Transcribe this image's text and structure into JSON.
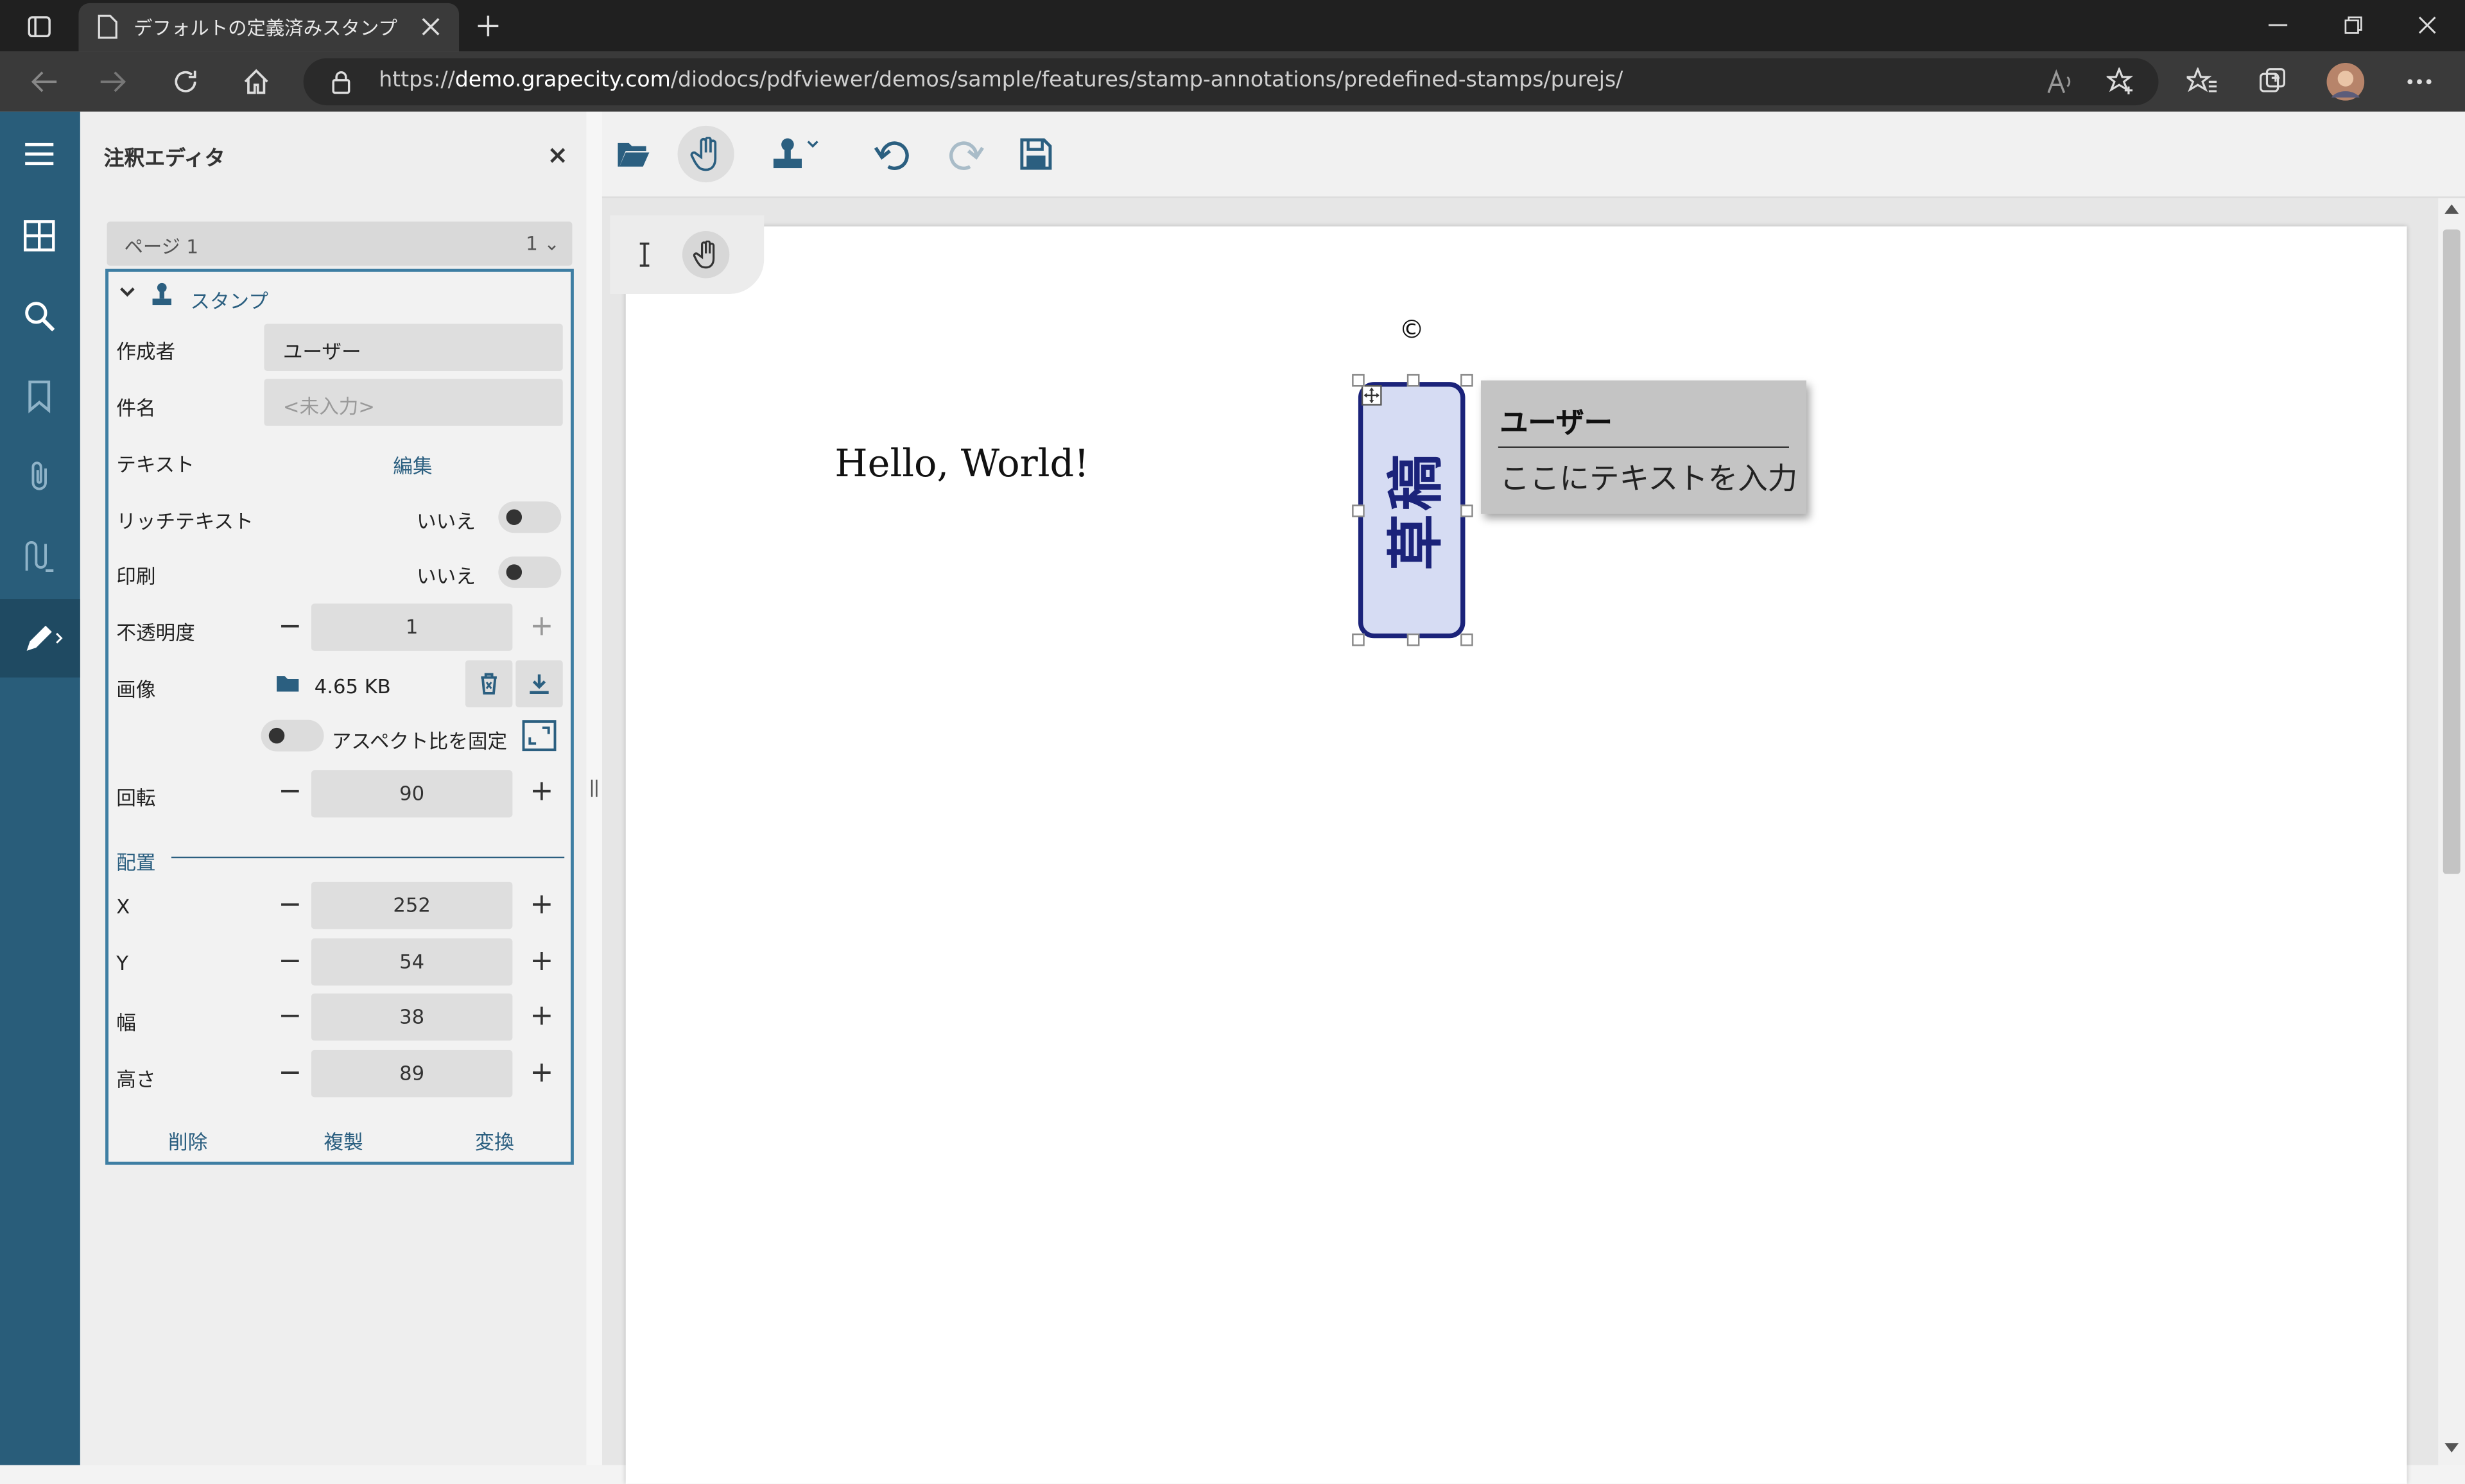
{
  "browser": {
    "tab_title": "デフォルトの定義済みスタンプ",
    "url_prefix": "https://",
    "url_host": "demo.grapecity.com",
    "url_path": "/diodocs/pdfviewer/demos/sample/features/stamp-annotations/predefined-stamps/purejs/"
  },
  "panel": {
    "title": "注釈エディタ",
    "close": "×",
    "page_select": {
      "label": "ページ 1",
      "value": "1"
    },
    "section": "スタンプ",
    "author_label": "作成者",
    "author_value": "ユーザー",
    "subject_label": "件名",
    "subject_placeholder": "<未入力>",
    "text_label": "テキスト",
    "text_edit": "編集",
    "richtext_label": "リッチテキスト",
    "richtext_value": "いいえ",
    "print_label": "印刷",
    "print_value": "いいえ",
    "opacity_label": "不透明度",
    "opacity_value": "1",
    "image_label": "画像",
    "image_size": "4.65 KB",
    "aspect_label": "アスペクト比を固定",
    "rotation_label": "回転",
    "rotation_value": "90",
    "layout_label": "配置",
    "x_label": "X",
    "x_value": "252",
    "y_label": "Y",
    "y_value": "54",
    "width_label": "幅",
    "width_value": "38",
    "height_label": "高さ",
    "height_value": "89",
    "minus": "−",
    "plus": "+",
    "actions": {
      "delete": "削除",
      "duplicate": "複製",
      "convert": "変換"
    }
  },
  "document": {
    "text": "Hello, World!",
    "stamp_text": "草稿",
    "copyright": "©",
    "note_author": "ユーザー",
    "note_text": "ここにテキストを入力"
  },
  "colors": {
    "sidebar": "#295d7a",
    "accent": "#3e7ea3",
    "stamp_border": "#1b237a",
    "stamp_fill": "#d6dcf3"
  },
  "icons": [
    "hamburger-icon",
    "thumbnails-icon",
    "search-icon",
    "bookmark-icon",
    "attachment-icon",
    "signature-icon",
    "pencil-icon",
    "folder-icon",
    "hand-icon",
    "stamp-icon",
    "undo-icon",
    "redo-icon",
    "save-icon",
    "text-cursor-icon"
  ]
}
